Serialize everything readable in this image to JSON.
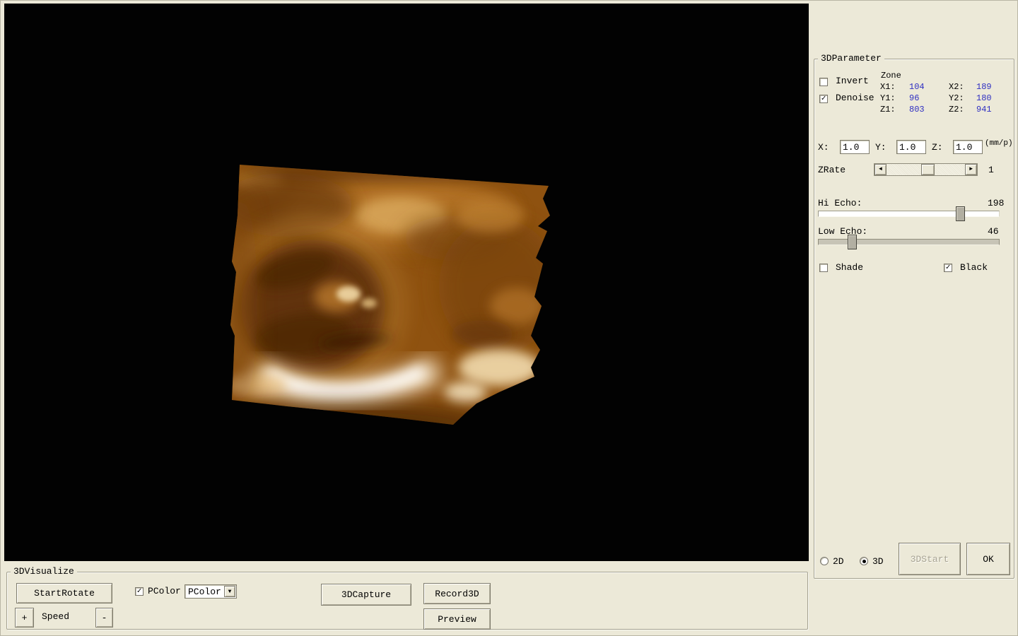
{
  "theme": {
    "window_bg": "#ece9d8",
    "viewport_bg": "#020202",
    "value_blue": "#2e2ec2",
    "render_base": "#8f5210",
    "render_highlight": "#fff3da"
  },
  "right_panel": {
    "title": "3DParameter",
    "invert": {
      "label": "Invert",
      "checked": false
    },
    "denoise": {
      "label": "Denoise",
      "checked": true
    },
    "zone": {
      "label": "Zone",
      "rows": [
        {
          "k1": "X1:",
          "v1": "104",
          "k2": "X2:",
          "v2": "189"
        },
        {
          "k1": "Y1:",
          "v1": "96",
          "k2": "Y2:",
          "v2": "180"
        },
        {
          "k1": "Z1:",
          "v1": "803",
          "k2": "Z2:",
          "v2": "941"
        }
      ]
    },
    "scale": {
      "x_label": "X:",
      "x_value": "1.0",
      "y_label": "Y:",
      "y_value": "1.0",
      "z_label": "Z:",
      "z_value": "1.0",
      "unit": "(mm/p)"
    },
    "zrate": {
      "label": "ZRate",
      "value": "1"
    },
    "hi_echo": {
      "label": "Hi Echo:",
      "value": "198"
    },
    "low_echo": {
      "label": "Low Echo:",
      "value": "46"
    },
    "shade": {
      "label": "Shade",
      "checked": false
    },
    "black": {
      "label": "Black",
      "checked": true
    },
    "mode_2d": {
      "label": "2D",
      "selected": false
    },
    "mode_3d": {
      "label": "3D",
      "selected": true
    },
    "start3d_button": {
      "label": "3DStart",
      "disabled": true
    },
    "ok_button": {
      "label": "OK"
    }
  },
  "bottom_panel": {
    "title": "3DVisualize",
    "start_rotate_button": "StartRotate",
    "pcolor_checkbox": {
      "label": "PColor",
      "checked": true
    },
    "pcolor_dropdown": {
      "value": "PColor"
    },
    "speed": {
      "plus": "+",
      "label": "Speed",
      "minus": "-"
    },
    "capture_button": "3DCapture",
    "record_button": "Record3D",
    "preview_button": "Preview"
  }
}
